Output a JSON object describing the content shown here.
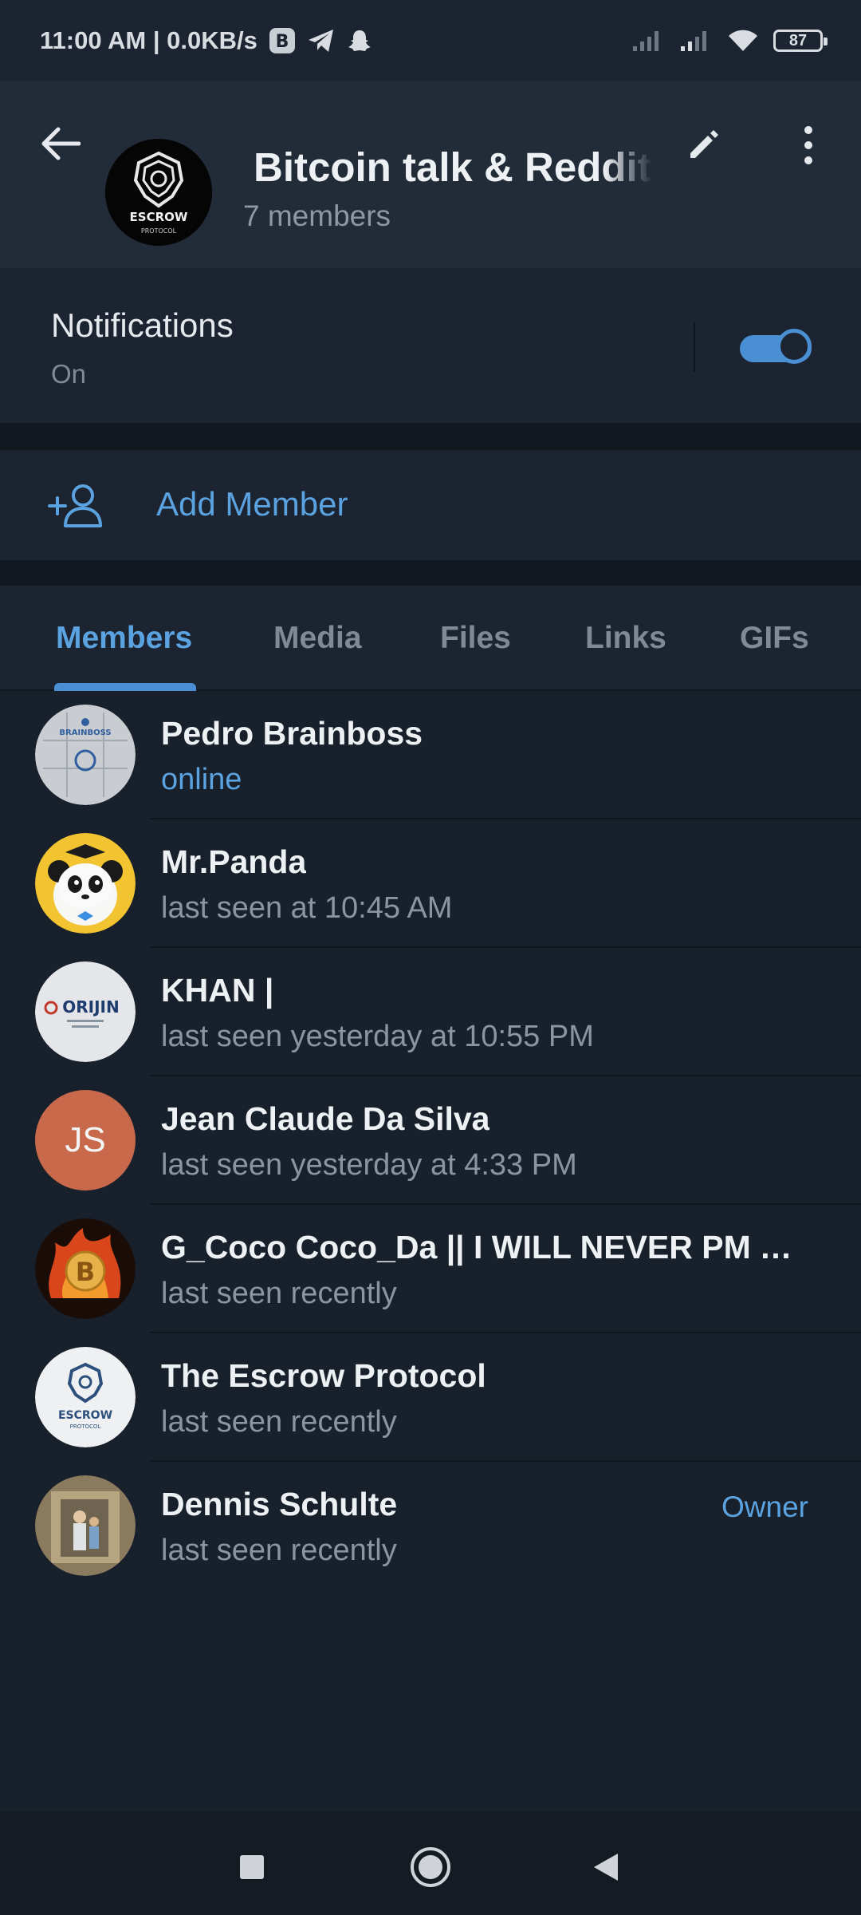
{
  "status_bar": {
    "time_speed": "11:00 AM | 0.0KB/s",
    "battery": "87"
  },
  "header": {
    "title": "Bitcoin talk & Reddit Campaign",
    "subtitle": "7 members",
    "avatar_text": "ESCROW",
    "avatar_subtext": "PROTOCOL"
  },
  "notifications": {
    "title": "Notifications",
    "state": "On",
    "enabled": true
  },
  "add_member": {
    "label": "Add Member"
  },
  "tabs": [
    {
      "label": "Members",
      "active": true
    },
    {
      "label": "Media",
      "active": false
    },
    {
      "label": "Files",
      "active": false
    },
    {
      "label": "Links",
      "active": false
    },
    {
      "label": "GIFs",
      "active": false
    }
  ],
  "members": [
    {
      "name": "Pedro Brainboss",
      "status": "online",
      "role": "",
      "avatar_text": "BRAINBOSS"
    },
    {
      "name": "Mr.Panda",
      "status": "last seen at 10:45 AM",
      "role": "",
      "avatar_text": ""
    },
    {
      "name": "KHAN |",
      "status": "last seen yesterday at 10:55 PM",
      "role": "",
      "avatar_text": "ORIJIN"
    },
    {
      "name": "Jean Claude Da Silva",
      "status": "last seen yesterday at 4:33 PM",
      "role": "",
      "avatar_text": "JS"
    },
    {
      "name": "G_Coco Coco_Da || I WILL NEVER PM Y...",
      "status": "last seen recently",
      "role": "",
      "avatar_text": ""
    },
    {
      "name": "The Escrow Protocol",
      "status": "last seen recently",
      "role": "",
      "avatar_text": "ESCROW"
    },
    {
      "name": "Dennis Schulte",
      "status": "last seen recently",
      "role": "Owner",
      "avatar_text": ""
    }
  ],
  "colors": {
    "accent": "#5ba3e0",
    "background": "#18202b",
    "panel": "#1b2430",
    "header": "#222c39",
    "js_avatar": "#c8694b"
  }
}
